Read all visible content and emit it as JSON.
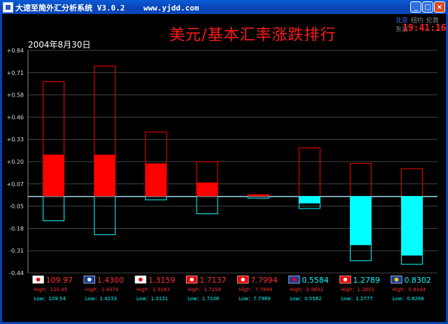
{
  "window": {
    "title": "大速至简外汇分析系统 V3.0.2    www.yjdd.com",
    "buttons": {
      "minimize": "_",
      "maximize": "□",
      "close": "×"
    }
  },
  "header": {
    "title": "美元/基本汇率涨跌排行",
    "date": "2004年8月30日",
    "cities": [
      "北京",
      "纽约",
      "伦敦",
      "东京"
    ],
    "active_city": "北京",
    "clock": "19:41:16"
  },
  "colors": {
    "up": "#ff0000",
    "down": "#00ffff",
    "zero_line": "#9ad8e6",
    "grid": "#444444",
    "label": "#ff3030"
  },
  "chart_data": {
    "type": "bar",
    "title": "美元/基本汇率涨跌排行",
    "ylim": [
      -0.44,
      0.84
    ],
    "yticks": [
      "+0.84",
      "+0.71",
      "+0.58",
      "+0.46",
      "+0.33",
      "+0.20",
      "+0.07",
      "-0.05",
      "-0.18",
      "-0.31",
      "-0.44"
    ],
    "items": [
      {
        "icon": "japan-flag-icon",
        "price": "109.97",
        "high": "High：110.45",
        "low": "Low：109.54",
        "change": 0.24,
        "range_high": 0.66,
        "range_low": -0.14
      },
      {
        "icon": "australia-flag-icon",
        "price": "1.4300",
        "high": "High：1.4374",
        "low": "Low：1.4233",
        "change": 0.24,
        "range_high": 0.75,
        "range_low": -0.22
      },
      {
        "icon": "canada-flag-icon",
        "price": "1.3159",
        "high": "High：1.3183",
        "low": "Low：1.3131",
        "change": 0.19,
        "range_high": 0.37,
        "range_low": -0.02
      },
      {
        "icon": "singapore-flag-icon",
        "price": "1.7137",
        "high": "High：1.7158",
        "low": "Low：1.7106",
        "change": 0.08,
        "range_high": 0.2,
        "range_low": -0.1
      },
      {
        "icon": "hongkong-flag-icon",
        "price": "7.7994",
        "high": "High：7.7999",
        "low": "Low：7.7989",
        "change": 0.01,
        "range_high": 0.01,
        "range_low": -0.01
      },
      {
        "icon": "uk-flag-icon",
        "price": "0.5584",
        "high": "High：0.5602",
        "low": "Low：0.5582",
        "change": -0.04,
        "range_high": 0.28,
        "range_low": -0.07
      },
      {
        "icon": "switzerland-flag-icon",
        "price": "1.2789",
        "high": "High：1.2851",
        "low": "Low：1.2777",
        "change": -0.28,
        "range_high": 0.19,
        "range_low": -0.37
      },
      {
        "icon": "eu-flag-icon",
        "price": "0.8302",
        "high": "High：0.8344",
        "low": "Low：0.8298",
        "change": -0.34,
        "range_high": 0.16,
        "range_low": -0.39
      }
    ]
  }
}
